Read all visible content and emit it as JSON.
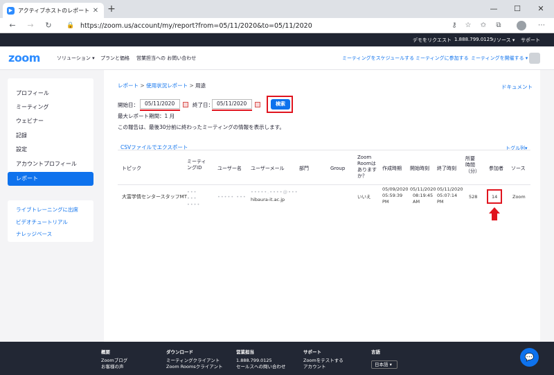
{
  "browser": {
    "tab_title": "アクティブホストのレポート - Zoom",
    "url": "https://zoom.us/account/my/report?from=05/11/2020&to=05/11/2020"
  },
  "topstrip": {
    "demo": "デモをリクエスト",
    "phone": "1.888.799.0125",
    "resources": "リソース ▾",
    "support": "サポート"
  },
  "nav": {
    "logo": "zoom",
    "solutions": "ソリューション ▾",
    "plans": "プランと価格",
    "sales": "営業担当への お問い合わせ",
    "schedule": "ミーティングをスケジュールする",
    "join": "ミーティングに参加する",
    "host": "ミーティングを開催する ▾"
  },
  "sidebar": {
    "items": [
      "プロフィール",
      "ミーティング",
      "ウェビナー",
      "記録",
      "設定",
      "アカウントプロフィール",
      "レポート"
    ],
    "links": [
      "ライブトレーニングに出席",
      "ビデオチュートリアル",
      "ナレッジベース"
    ]
  },
  "main": {
    "breadcrumb": [
      "レポート",
      ">",
      "使用状況レポート",
      ">",
      "用途"
    ],
    "docs": "ドキュメント",
    "start_label": "開始日：",
    "start_value": "05/11/2020",
    "end_label": "終了日：",
    "end_value": "05/11/2020",
    "search": "検索",
    "max_period": "最大レポート期間：1 月",
    "note": "この報告は、最後30分前に終わったミーティングの情報を表示します。",
    "csv": "CSVファイルでエクスポート",
    "toggle": "トグル列▾"
  },
  "table": {
    "headers": {
      "topic": "トピック",
      "meeting_id": "ミーティングID",
      "user_name": "ユーザー名",
      "user_email": "ユーザーメール",
      "dept": "部門",
      "group": "Group",
      "zoom_room": "Zoom Roomはありますか？",
      "created": "作成時期",
      "start": "開始時刻",
      "end": "終了時刻",
      "duration": "所要時間（分）",
      "participants": "参加者",
      "source": "ソース"
    },
    "row": {
      "topic": "大富学情センタースタッフMT",
      "meeting_id": "••• ••• ••••",
      "user_name": "••••• •••",
      "email_blur": "•••••.••••@•••",
      "email_domain": "hibaura-it.ac.jp",
      "zoom_room": "いいえ",
      "created_date": "05/09/2020",
      "created_time": "05:59:39",
      "created_pm": "PM",
      "start_date": "05/11/2020",
      "start_time": "08:19:45",
      "start_am": "AM",
      "end_date": "05/11/2020",
      "end_time": "05:07:14",
      "end_pm": "PM",
      "duration": "528",
      "participants": "14",
      "source": "Zoom"
    }
  },
  "footer": {
    "col1_head": "概要",
    "col1": [
      "Zoomブログ",
      "お客様の声"
    ],
    "col2_head": "ダウンロード",
    "col2": [
      "ミーティングクライアント",
      "Zoom Roomsクライアント"
    ],
    "col3_head": "営業担当",
    "col3": [
      "1.888.799.0125",
      "セールスへの問い合わせ"
    ],
    "col4_head": "サポート",
    "col4": [
      "Zoomをテストする",
      "アカウント"
    ],
    "col5_head": "言語",
    "lang": "日本語 ▾"
  },
  "colors": {
    "accent": "#0e72ed",
    "highlight": "#e0141e"
  }
}
